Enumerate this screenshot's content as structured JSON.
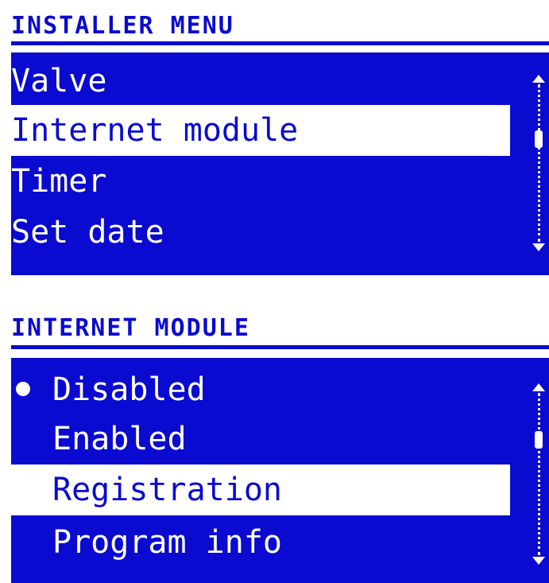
{
  "installer_menu": {
    "title": "INSTALLER MENU",
    "items": [
      {
        "label": "Valve",
        "selected": false
      },
      {
        "label": "Internet module",
        "selected": true
      },
      {
        "label": "Timer",
        "selected": false
      },
      {
        "label": "Set date",
        "selected": false
      }
    ]
  },
  "internet_module": {
    "title": "INTERNET MODULE",
    "items": [
      {
        "label": "Disabled",
        "active": true,
        "selected": false
      },
      {
        "label": "Enabled",
        "active": false,
        "selected": false
      },
      {
        "label": "Registration",
        "active": false,
        "selected": true
      },
      {
        "label": "Program info",
        "active": false,
        "selected": false
      }
    ]
  },
  "colors": {
    "accent": "#0a0ad0",
    "text_on_accent": "#ffffff"
  },
  "icons": [
    "selected-option-dot-icon",
    "scroll-up-arrow-icon",
    "scroll-down-arrow-icon"
  ]
}
